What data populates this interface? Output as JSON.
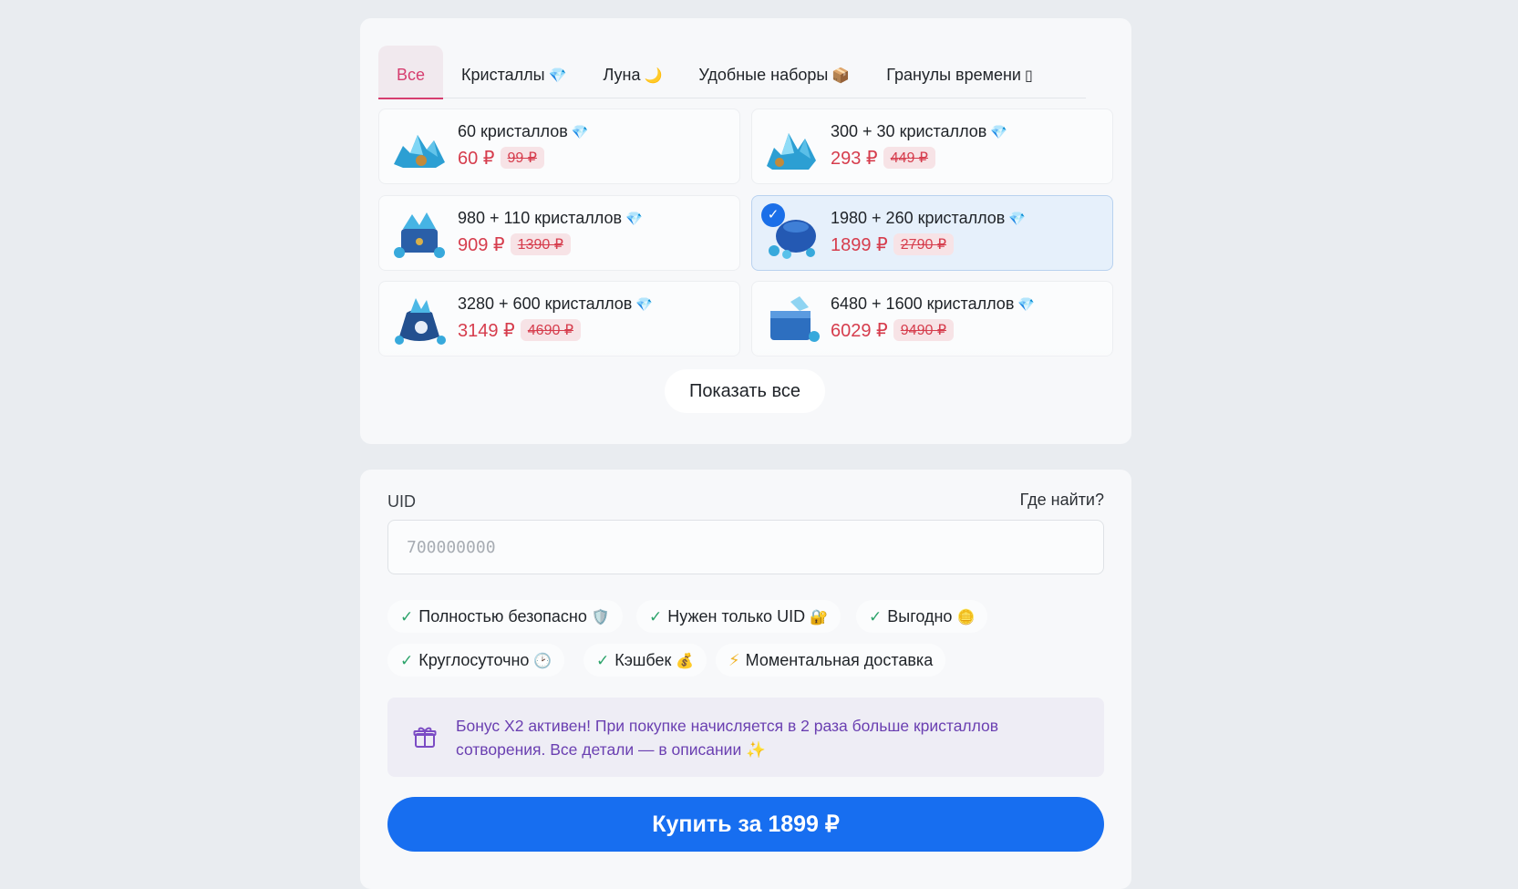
{
  "tabs": [
    {
      "label": "Все",
      "icon": ""
    },
    {
      "label": "Кристаллы",
      "icon": "💎"
    },
    {
      "label": "Луна",
      "icon": "🌙"
    },
    {
      "label": "Удобные наборы",
      "icon": "📦"
    },
    {
      "label": "Гранулы времени",
      "icon": "▯"
    }
  ],
  "products": [
    {
      "name": "60 кристаллов",
      "price": "60 ₽",
      "old_price": "99 ₽",
      "selected": false
    },
    {
      "name": "300 + 30 кристаллов",
      "price": "293 ₽",
      "old_price": "449 ₽",
      "selected": false
    },
    {
      "name": "980 + 110 кристаллов",
      "price": "909 ₽",
      "old_price": "1390 ₽",
      "selected": false
    },
    {
      "name": "1980 + 260 кристаллов",
      "price": "1899 ₽",
      "old_price": "2790 ₽",
      "selected": true
    },
    {
      "name": "3280 + 600 кристаллов",
      "price": "3149 ₽",
      "old_price": "4690 ₽",
      "selected": false
    },
    {
      "name": "6480 + 1600 кристаллов",
      "price": "6029 ₽",
      "old_price": "9490 ₽",
      "selected": false
    }
  ],
  "gem_icon": "💎",
  "check_mark": "✓",
  "show_all_label": "Показать все",
  "uid": {
    "label": "UID",
    "help_link": "Где найти?",
    "placeholder": "700000000",
    "value": ""
  },
  "features": [
    {
      "label": "Полностью безопасно",
      "emoji": "🛡️",
      "mark": "✓"
    },
    {
      "label": "Нужен только UID",
      "emoji": "🔐",
      "mark": "✓"
    },
    {
      "label": "Выгодно",
      "emoji": "🪙",
      "mark": "✓"
    },
    {
      "label": "Круглосуточно",
      "emoji": "🕑",
      "mark": "✓"
    },
    {
      "label": "Кэшбек",
      "emoji": "💰",
      "mark": "✓"
    },
    {
      "label": "Моментальная доставка",
      "emoji": "",
      "mark": "⚡"
    }
  ],
  "bonus": {
    "text": "Бонус X2 активен! При покупке начисляется в 2 раза больше кристаллов сотворения. Все детали — в описании ✨"
  },
  "buy_label": "Купить за 1899 ₽",
  "colors": {
    "accent": "#176ef0",
    "price": "#d63d4d",
    "tab_active": "#d63d6f",
    "bonus_text": "#6a3fb1"
  }
}
